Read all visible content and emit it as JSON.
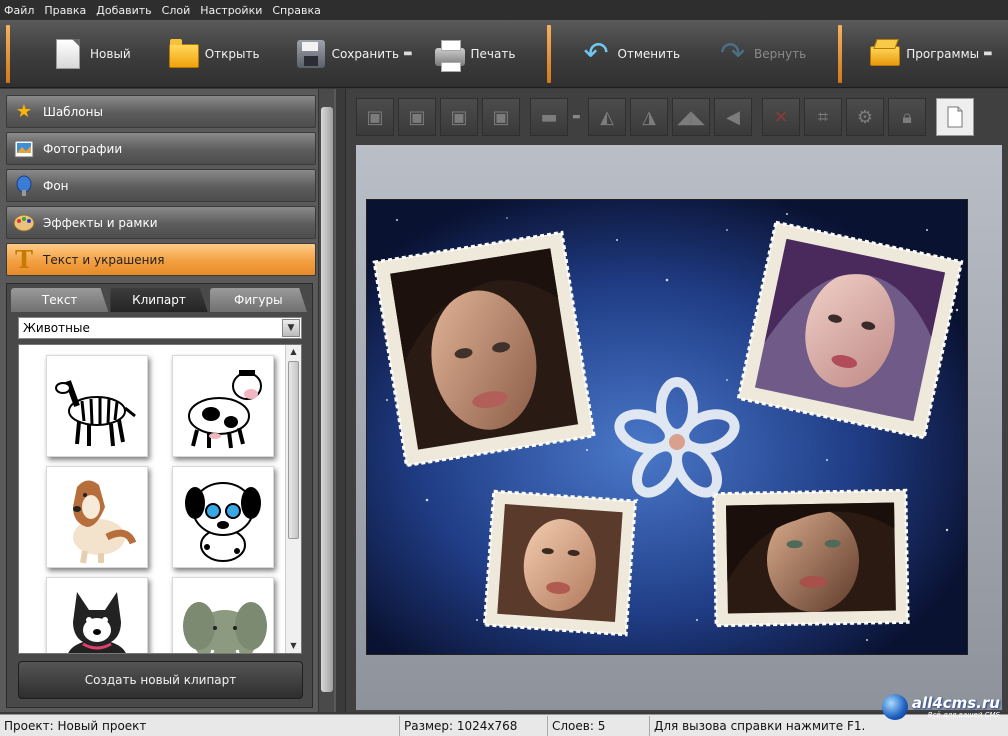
{
  "menu": [
    "Файл",
    "Правка",
    "Добавить",
    "Слой",
    "Настройки",
    "Справка"
  ],
  "toolbar": {
    "new": "Новый",
    "open": "Открыть",
    "save": "Сохранить",
    "print": "Печать",
    "undo": "Отменить",
    "redo": "Вернуть",
    "programs": "Программы"
  },
  "categories": [
    {
      "label": "Шаблоны",
      "icon": "star-icon"
    },
    {
      "label": "Фотографии",
      "icon": "photo-icon"
    },
    {
      "label": "Фон",
      "icon": "paint-brush-icon"
    },
    {
      "label": "Эффекты и рамки",
      "icon": "palette-icon"
    },
    {
      "label": "Текст и украшения",
      "icon": "text-t-icon",
      "active": true
    }
  ],
  "subtabs": [
    "Текст",
    "Клипарт",
    "Фигуры"
  ],
  "active_subtab": "Клипарт",
  "clipart_category": "Животные",
  "clipart_items": [
    "zebra",
    "cow",
    "collie",
    "dalmatian-puppy",
    "husky-puppy",
    "elephant"
  ],
  "create_clipart": "Создать новый клипарт",
  "edit_tools": [
    "layer-front-icon",
    "layer-forward-icon",
    "layer-backward-icon",
    "layer-back-icon",
    "align-icon",
    "rotate-left-icon",
    "rotate-right-icon",
    "flip-horizontal-icon",
    "flip-vertical-icon",
    "delete-icon",
    "crop-icon",
    "settings-icon",
    "lock-icon",
    "new-page-icon"
  ],
  "status": {
    "project": "Проект: Новый проект",
    "size": "Размер: 1024x768",
    "layers": "Слоев: 5",
    "help": "Для вызова справки нажмите F1."
  },
  "watermark": {
    "text": "all4cms.ru",
    "sub": "Всё для вашей CMS"
  },
  "colors": {
    "accent_orange": "#f3a042",
    "toolbar_bg": "#3e3e3e",
    "canvas_space": "#1a2f6b"
  }
}
